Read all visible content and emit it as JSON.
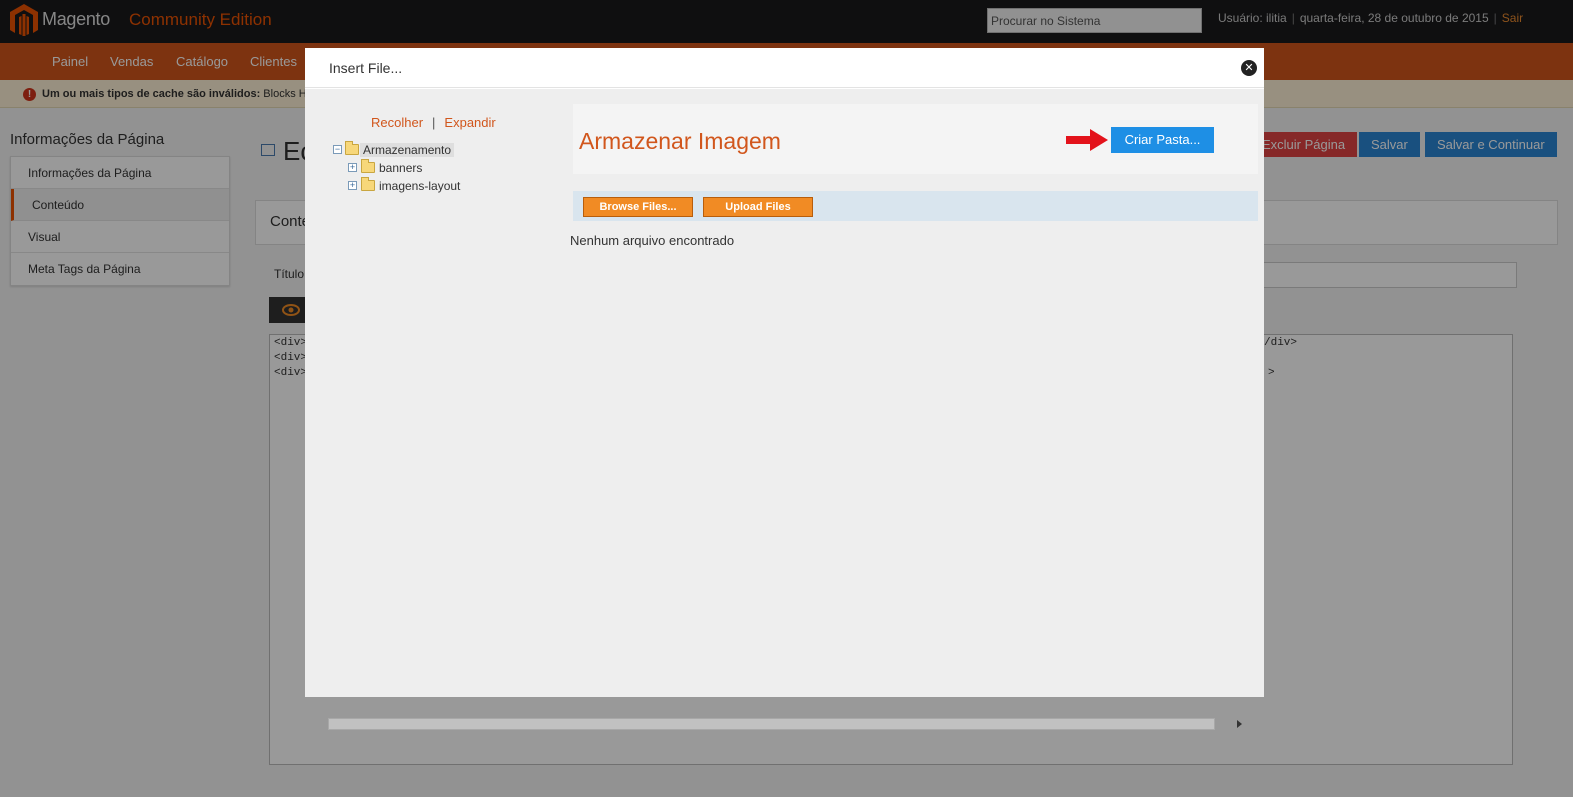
{
  "app": {
    "logo_text": "Magento",
    "edition": "Community Edition",
    "search_placeholder": "Procurar no Sistema",
    "user_label": "Usuário: ilitia",
    "date": "quarta-feira, 28 de outubro de 2015",
    "logout": "Sair"
  },
  "nav": {
    "items": [
      "Painel",
      "Vendas",
      "Catálogo",
      "Clientes"
    ]
  },
  "notice": {
    "bold_text": "Um ou mais tipos de cache são inválidos:",
    "text": "Blocks H"
  },
  "sidebar": {
    "title": "Informações da Página",
    "tabs": [
      "Informações da Página",
      "Conteúdo",
      "Visual",
      "Meta Tags da Página"
    ],
    "active_tab": "Conteúdo"
  },
  "page": {
    "heading_partial": "Ec",
    "buttons": {
      "delete": "Excluir Página",
      "save": "Salvar",
      "save_continue": "Salvar e Continuar"
    },
    "content_box_title": "Conte",
    "title_label": "Título",
    "editor_lines": [
      "<div>",
      "<div>",
      "<div>"
    ],
    "editor_tails": [
      "/div>",
      ">"
    ]
  },
  "modal": {
    "title": "Insert File...",
    "close_glyph": "✕",
    "tree_actions": {
      "collapse": "Recolher",
      "separator": "|",
      "expand": "Expandir"
    },
    "tree": {
      "root": "Armazenamento",
      "children": [
        "banners",
        "imagens-layout"
      ]
    },
    "store_title": "Armazenar Imagem",
    "create_folder_button": "Criar Pasta...",
    "browse_button": "Browse Files...",
    "upload_button": "Upload Files",
    "empty_message": "Nenhum arquivo encontrado"
  },
  "colors": {
    "brand_orange": "#eb5202",
    "nav_bar": "#d1561c",
    "accent_blue": "#1e8fe5",
    "arrow_red": "#e3121b"
  }
}
